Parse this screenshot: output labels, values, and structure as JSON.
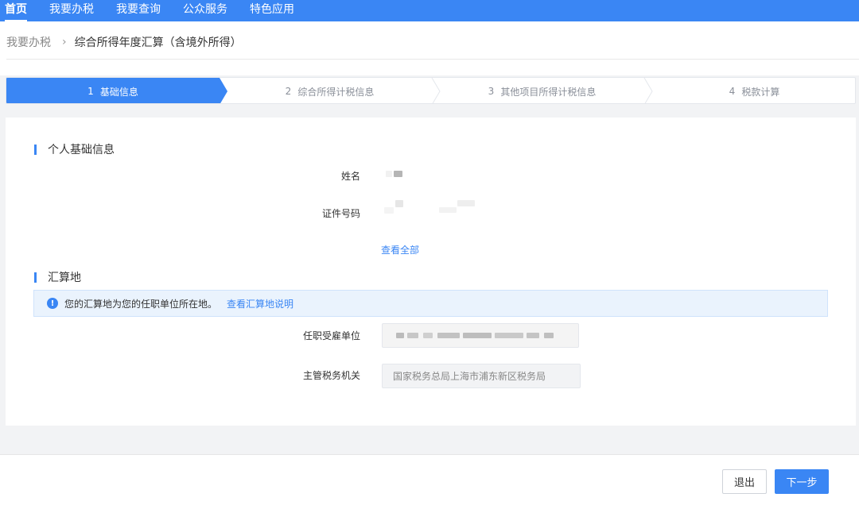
{
  "nav": {
    "items": [
      "首页",
      "我要办税",
      "我要查询",
      "公众服务",
      "特色应用"
    ],
    "active_index": 0
  },
  "breadcrumb": {
    "parent": "我要办税",
    "separator": "›",
    "current": "综合所得年度汇算（含境外所得）"
  },
  "steps": [
    {
      "num": "1",
      "label": "基础信息",
      "active": true
    },
    {
      "num": "2",
      "label": "综合所得计税信息",
      "active": false
    },
    {
      "num": "3",
      "label": "其他项目所得计税信息",
      "active": false
    },
    {
      "num": "4",
      "label": "税款计算",
      "active": false
    }
  ],
  "personal": {
    "title": "个人基础信息",
    "name_label": "姓名",
    "id_label": "证件号码",
    "view_all": "查看全部"
  },
  "settlement": {
    "title": "汇算地",
    "info_text": "您的汇算地为您的任职单位所在地。",
    "info_link": "查看汇算地说明",
    "employer_label": "任职受雇单位",
    "tax_authority_label": "主管税务机关",
    "tax_authority_value": "国家税务总局上海市浦东新区税务局"
  },
  "footer": {
    "exit_label": "退出",
    "next_label": "下一步"
  },
  "colors": {
    "primary": "#3a86f4",
    "info_bg": "#eaf3fd"
  }
}
